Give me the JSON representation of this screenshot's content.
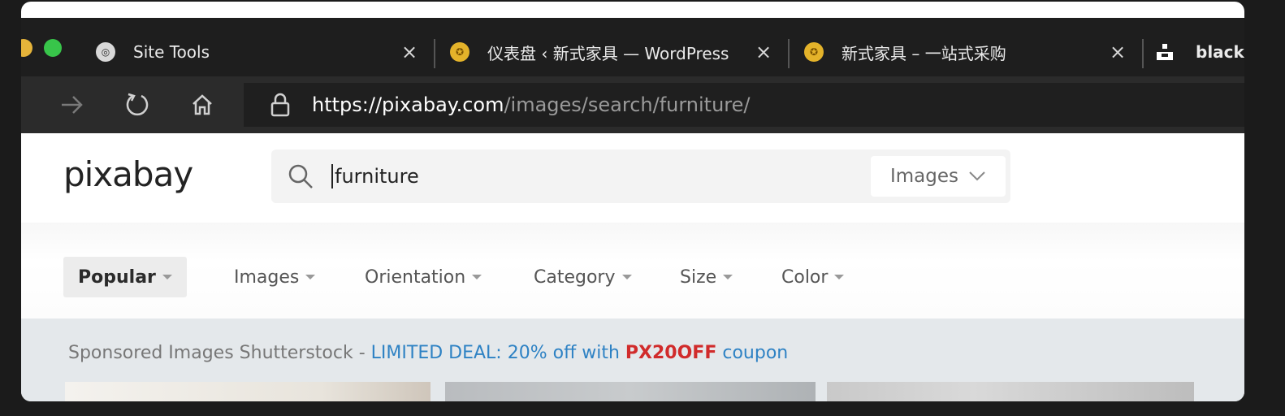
{
  "browser": {
    "tabs": [
      {
        "title": "Site Tools",
        "favicon": "site-tools-favicon",
        "close": "×"
      },
      {
        "title": "仪表盘 ‹ 新式家具 — WordPress",
        "favicon": "wordpress-favicon",
        "close": "×"
      },
      {
        "title": "新式家具 – 一站式采购",
        "favicon": "wordpress-favicon",
        "close": "×"
      },
      {
        "title": "black",
        "favicon": "black-favicon"
      }
    ],
    "url": {
      "scheme": "https://",
      "host": "pixabay.com",
      "path": "/images/search/furniture/"
    }
  },
  "site": {
    "logo": "pixabay",
    "search": {
      "query": "furniture",
      "type": "Images"
    },
    "filters": [
      "Popular",
      "Images",
      "Orientation",
      "Category",
      "Size",
      "Color"
    ],
    "sponsored": {
      "lead": "Sponsored Images Shutterstock - ",
      "deal": "LIMITED DEAL: 20% off with ",
      "code": "PX20OFF",
      "tail": " coupon"
    }
  },
  "colors": {
    "chrome_dark": "#1e1e1e",
    "deal_blue": "#2e82c4",
    "code_red": "#d12b2b"
  }
}
